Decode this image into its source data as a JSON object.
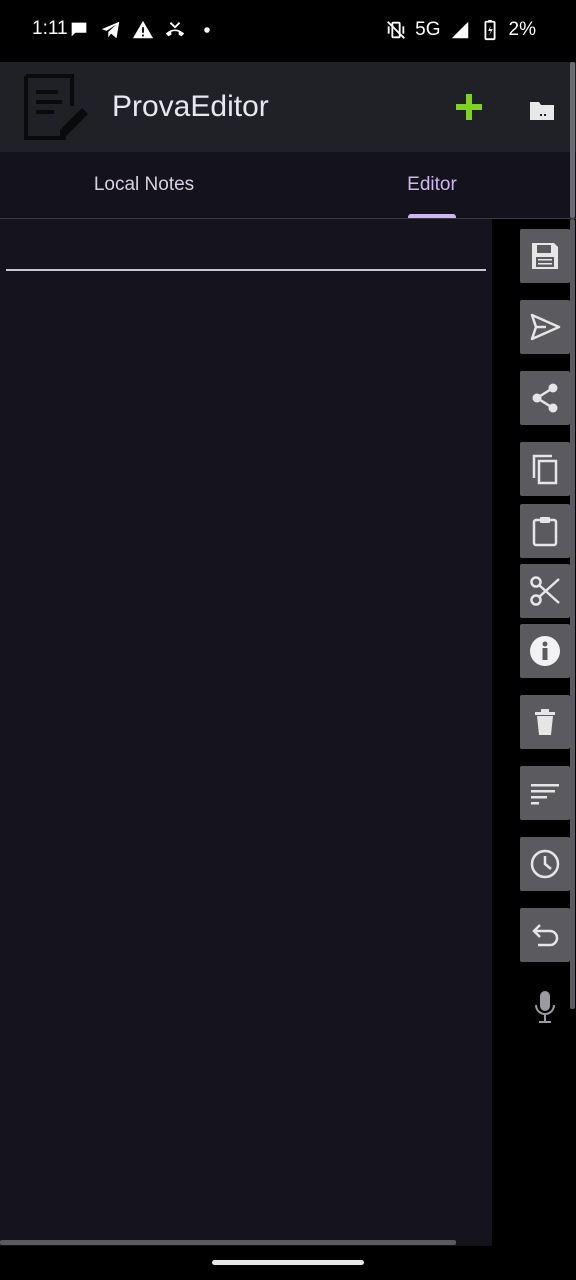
{
  "status_bar": {
    "time": "1:11",
    "network": "5G",
    "battery": "2%",
    "left_icons": [
      "chat-icon",
      "telegram-icon",
      "warning-icon",
      "missed-call-icon",
      "dot-icon"
    ],
    "right_icons": [
      "vibrate-off-icon",
      "signal-icon",
      "battery-charging-icon"
    ]
  },
  "app_bar": {
    "title": "ProvaEditor",
    "add_icon": "plus-icon",
    "folder_icon": "folder-icon",
    "add_color": "#7ed321"
  },
  "tabs": [
    {
      "label": "Local Notes",
      "selected": false
    },
    {
      "label": "Editor",
      "selected": true
    }
  ],
  "editor": {
    "title_value": "",
    "title_placeholder": ""
  },
  "toolbar": {
    "buttons": [
      "save",
      "send",
      "share",
      "copy",
      "paste",
      "cut",
      "info",
      "delete",
      "format",
      "history",
      "undo"
    ],
    "mic": "microphone"
  },
  "colors": {
    "accent": "#cdb6f2",
    "app_bar": "#202027",
    "editor_bg": "#15131b",
    "tool_button": "#5b5b5f"
  }
}
